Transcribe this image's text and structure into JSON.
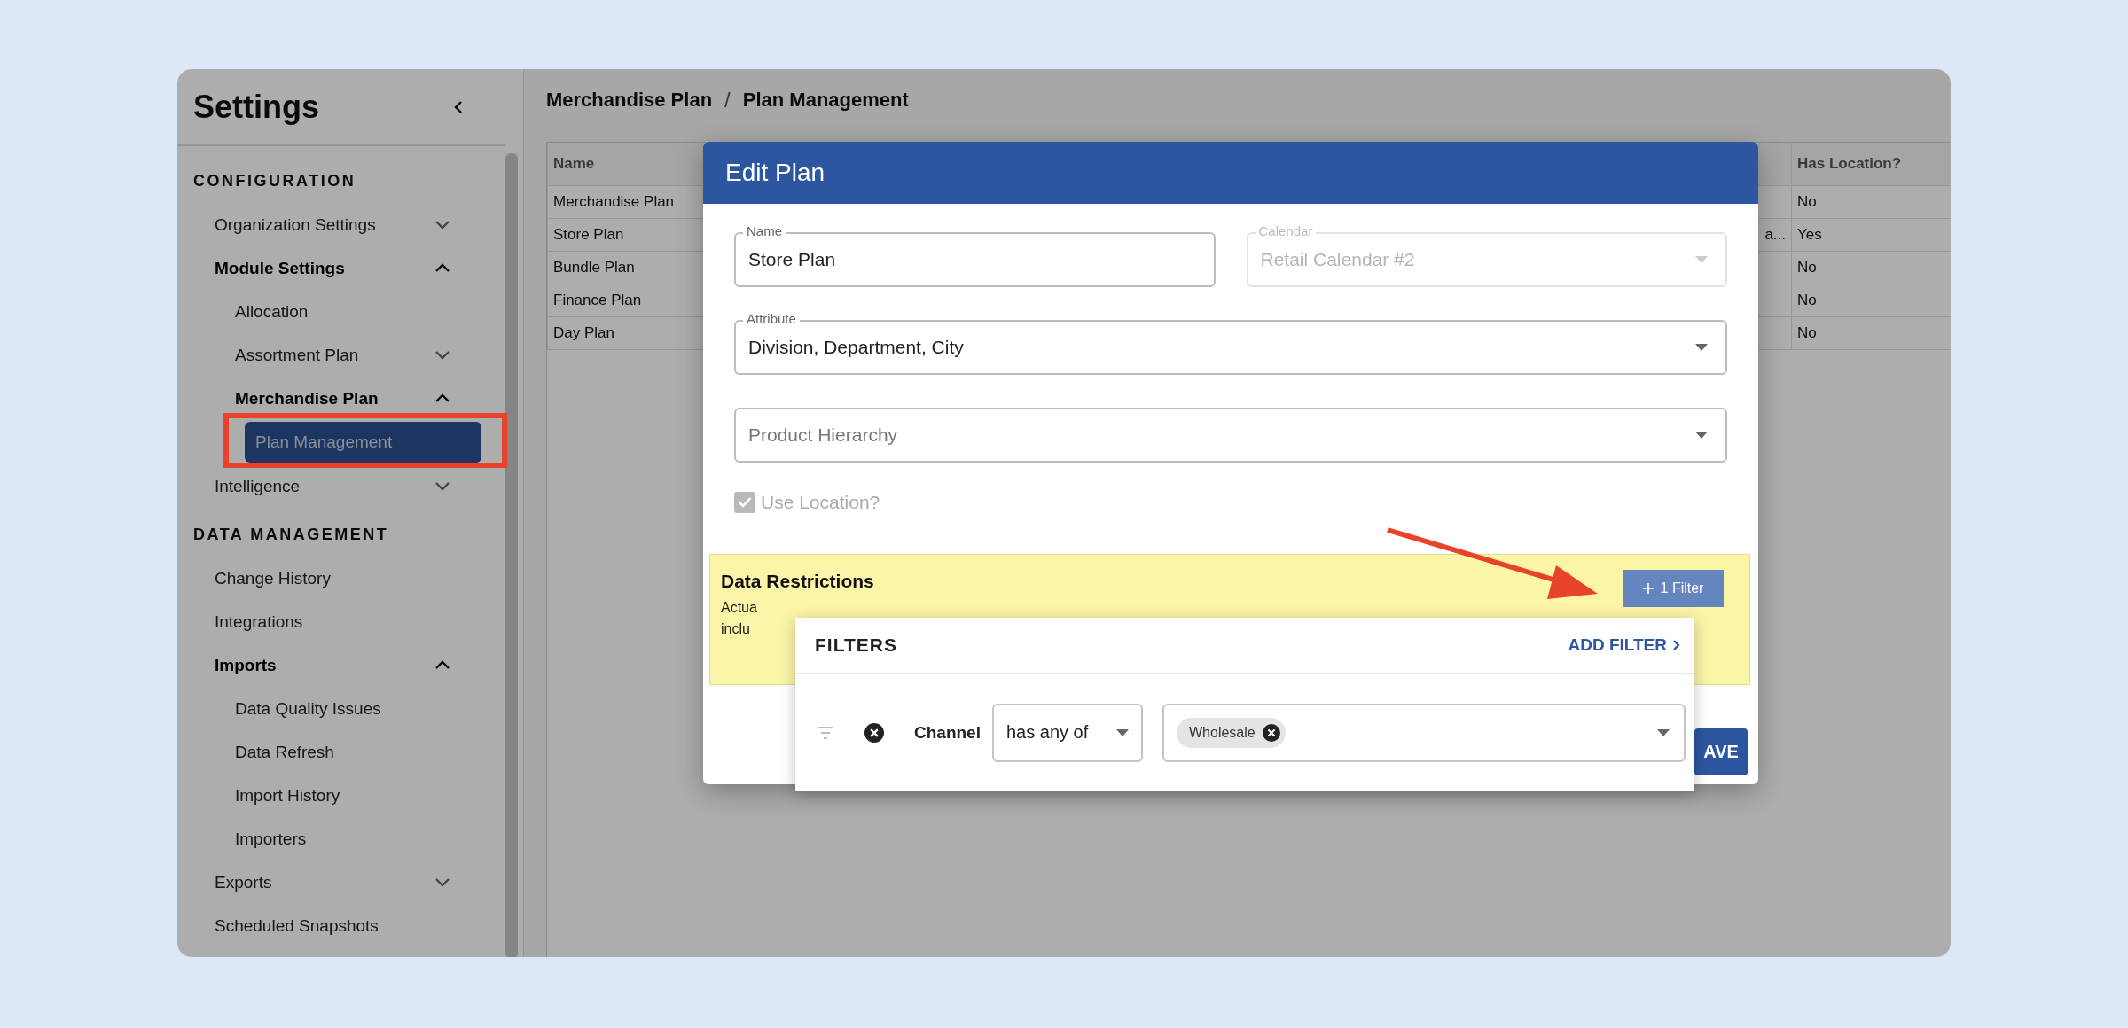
{
  "sidebar": {
    "title": "Settings",
    "sections": [
      {
        "title": "CONFIGURATION",
        "items": [
          {
            "label": "Organization Settings",
            "expanded": false,
            "selected": false
          },
          {
            "label": "Module Settings",
            "expanded": true,
            "selected": false,
            "children": [
              {
                "label": "Allocation",
                "selected": false
              },
              {
                "label": "Assortment Plan",
                "expanded": false,
                "selected": false
              },
              {
                "label": "Merchandise Plan",
                "expanded": true,
                "selected": false,
                "children": [
                  {
                    "label": "Plan Management",
                    "selected": true
                  }
                ]
              }
            ]
          },
          {
            "label": "Intelligence",
            "expanded": false,
            "selected": false
          }
        ]
      },
      {
        "title": "DATA MANAGEMENT",
        "items": [
          {
            "label": "Change History",
            "selected": false
          },
          {
            "label": "Integrations",
            "selected": false
          },
          {
            "label": "Imports",
            "expanded": true,
            "selected": false,
            "children": [
              {
                "label": "Data Quality Issues",
                "selected": false
              },
              {
                "label": "Data Refresh",
                "selected": false
              },
              {
                "label": "Import History",
                "selected": false
              },
              {
                "label": "Importers",
                "selected": false
              }
            ]
          },
          {
            "label": "Exports",
            "expanded": false,
            "selected": false
          },
          {
            "label": "Scheduled Snapshots",
            "selected": false
          }
        ]
      }
    ]
  },
  "breadcrumb": {
    "items": [
      "Merchandise Plan",
      "Plan Management"
    ],
    "separator": "/"
  },
  "table": {
    "columns": [
      "Name",
      "Has Location?"
    ],
    "rows": [
      {
        "name": "Merchandise Plan",
        "has_location": "No"
      },
      {
        "name": "Store Plan",
        "column_2": "a...",
        "has_location": "Yes"
      },
      {
        "name": "Bundle Plan",
        "has_location": "No"
      },
      {
        "name": "Finance Plan",
        "has_location": "No"
      },
      {
        "name": "Day Plan",
        "has_location": "No"
      }
    ]
  },
  "modal": {
    "title": "Edit Plan",
    "fields": [
      {
        "kind": "text",
        "label": "Name",
        "value": "Store Plan",
        "disabled": false
      },
      {
        "kind": "select",
        "label": "Calendar",
        "value": "Retail Calendar #2",
        "disabled": true
      },
      {
        "kind": "select",
        "label": "Attribute",
        "value": "Division, Department, City",
        "disabled": false
      },
      {
        "kind": "select",
        "placeholder": "Product Hierarchy",
        "disabled": false
      }
    ],
    "use_location": {
      "label": "Use Location?",
      "checked": true,
      "disabled": true
    },
    "data_restrictions": {
      "title": "Data Restrictions",
      "text_lines": [
        "Actua",
        "inclu"
      ],
      "filter_button": "1 Filter"
    },
    "save_button": "AVE"
  },
  "filters_popup": {
    "title": "FILTERS",
    "add_filter": "ADD FILTER",
    "rows": [
      {
        "field": "Channel",
        "operator": "has any of",
        "values": [
          "Wholesale"
        ]
      }
    ]
  }
}
